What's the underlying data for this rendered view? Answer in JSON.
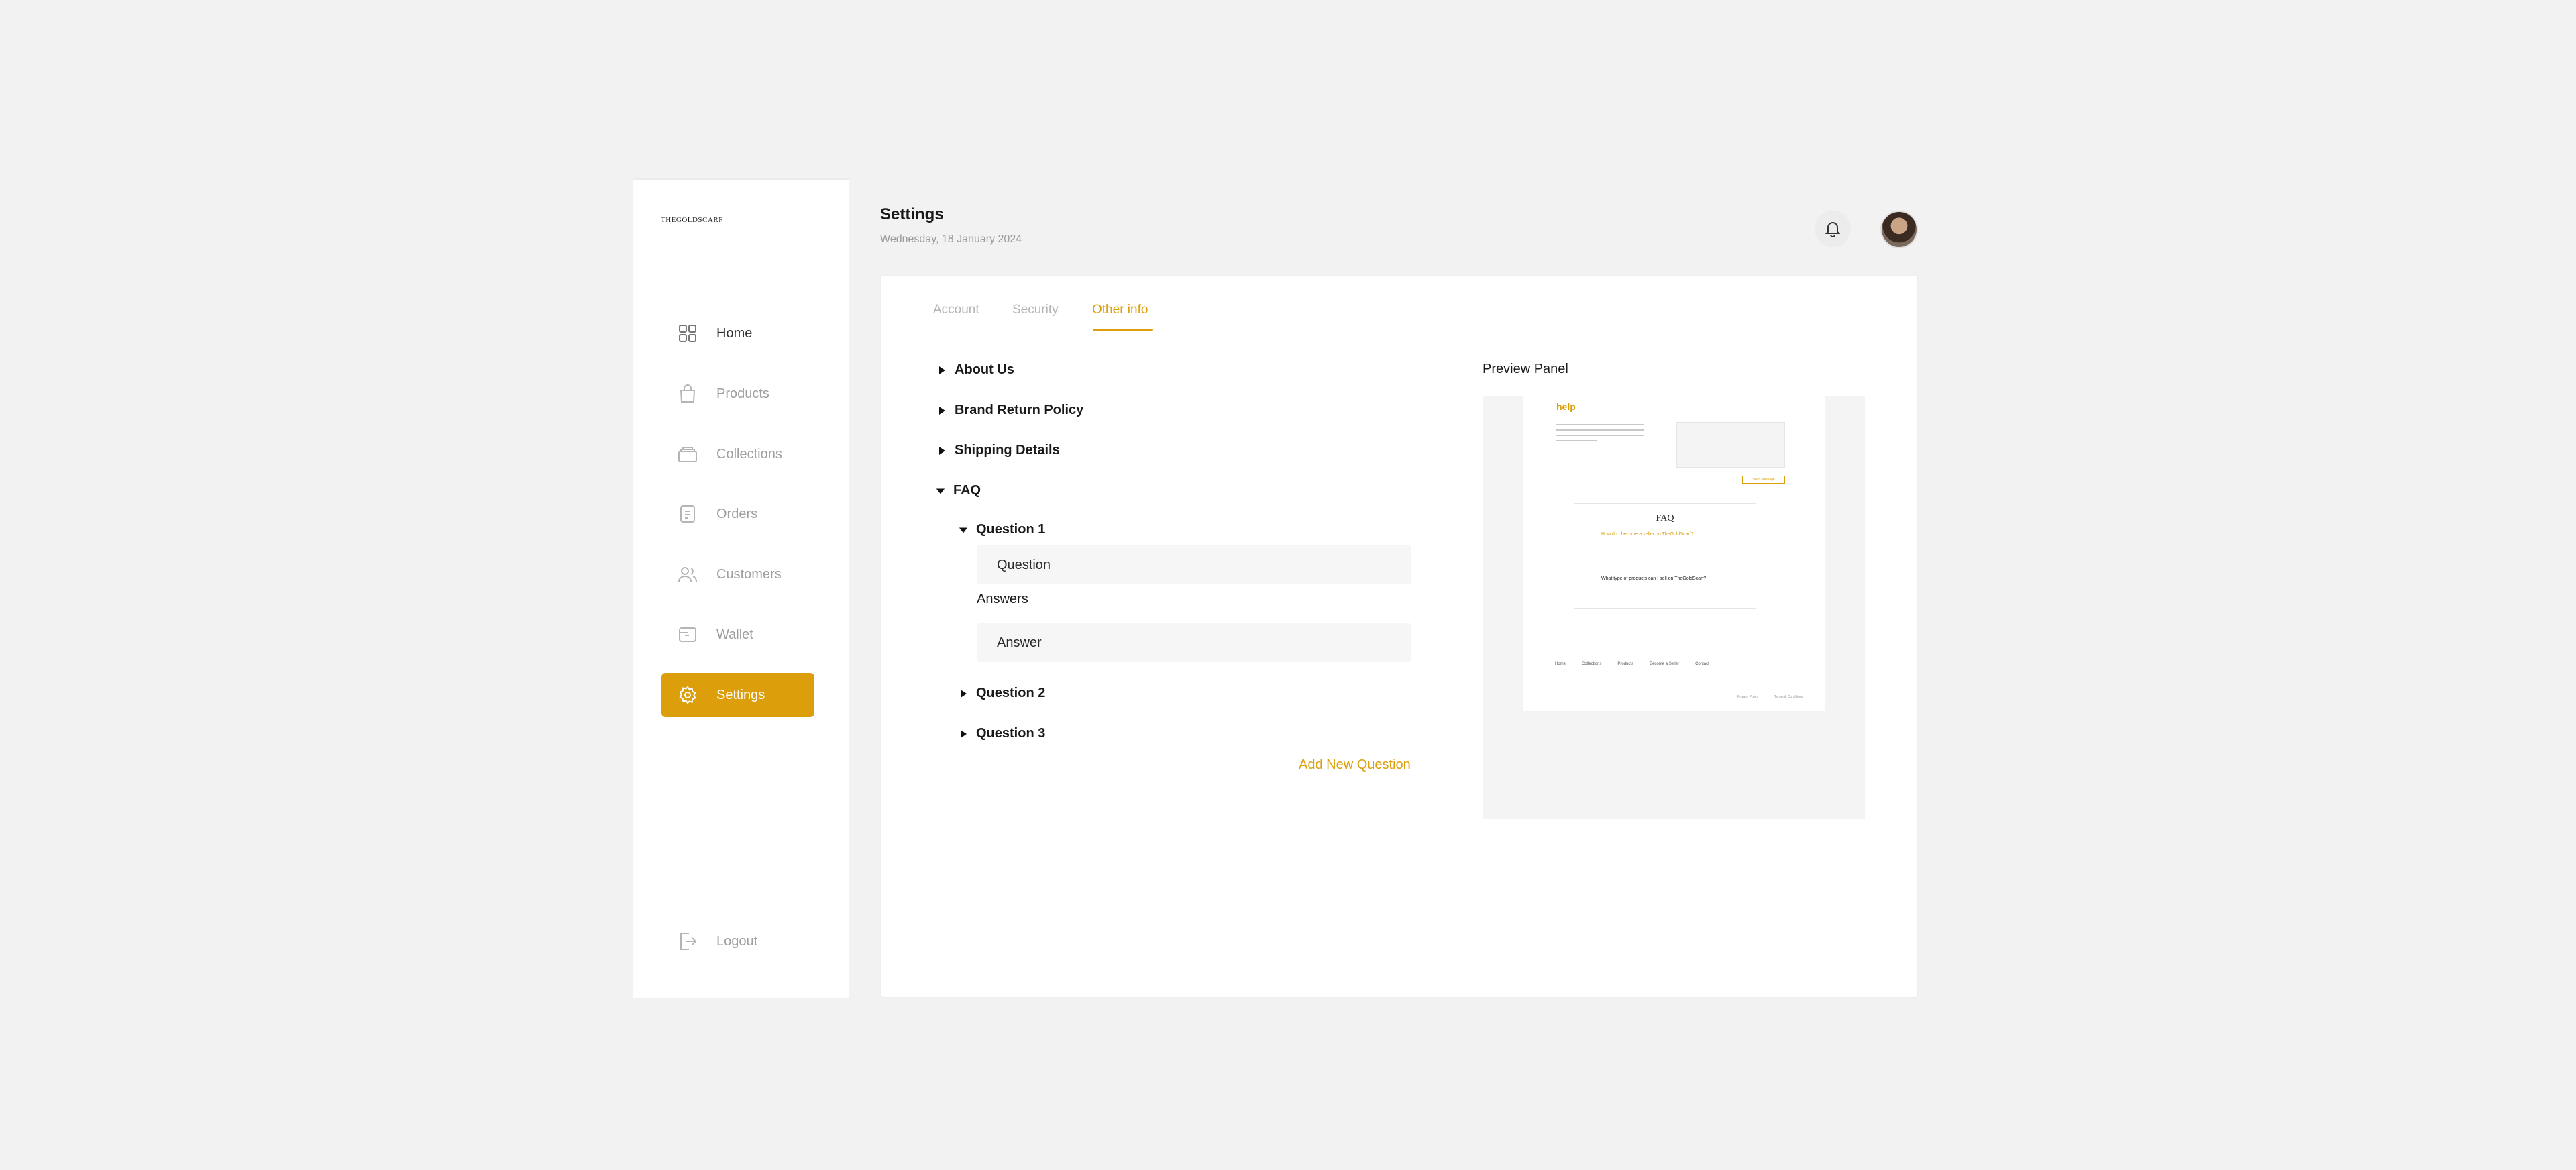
{
  "brand": {
    "logo_text": "THEGOLDSCARF"
  },
  "sidebar": {
    "items": [
      {
        "label": "Home",
        "icon": "grid-icon"
      },
      {
        "label": "Products",
        "icon": "bag-icon"
      },
      {
        "label": "Collections",
        "icon": "stack-icon"
      },
      {
        "label": "Orders",
        "icon": "receipt-icon"
      },
      {
        "label": "Customers",
        "icon": "users-icon"
      },
      {
        "label": "Wallet",
        "icon": "wallet-icon"
      },
      {
        "label": "Settings",
        "icon": "gear-icon",
        "active": true
      }
    ],
    "logout_label": "Logout"
  },
  "header": {
    "title": "Settings",
    "date": "Wednesday, 18 January 2024"
  },
  "tabs": [
    {
      "label": "Account"
    },
    {
      "label": "Security"
    },
    {
      "label": "Other info",
      "active": true
    }
  ],
  "sections": {
    "about": "About Us",
    "return_policy": "Brand Return Policy",
    "shipping": "Shipping Details",
    "faq": "FAQ"
  },
  "faq": {
    "question1": "Question 1",
    "question_placeholder": "Question",
    "answers_label": "Answers",
    "answer_placeholder": "Answer",
    "question2": "Question 2",
    "question3": "Question 3",
    "add_label": "Add New Question"
  },
  "preview": {
    "title": "Preview Panel",
    "help_text": "help",
    "faq_title": "FAQ",
    "q1": "How do I become a seller on TheGoldScarf?",
    "q2": "What type of products can I sell on TheGoldScarf?",
    "send_label": "Send Message",
    "footer_links": [
      "Home",
      "Collections",
      "Products",
      "Become a Seller",
      "Contact"
    ],
    "legal": [
      "Privacy Policy",
      "Terms & Conditions"
    ]
  },
  "colors": {
    "accent": "#dc9f0b",
    "background": "#f2f2f2",
    "panel": "#ffffff"
  }
}
